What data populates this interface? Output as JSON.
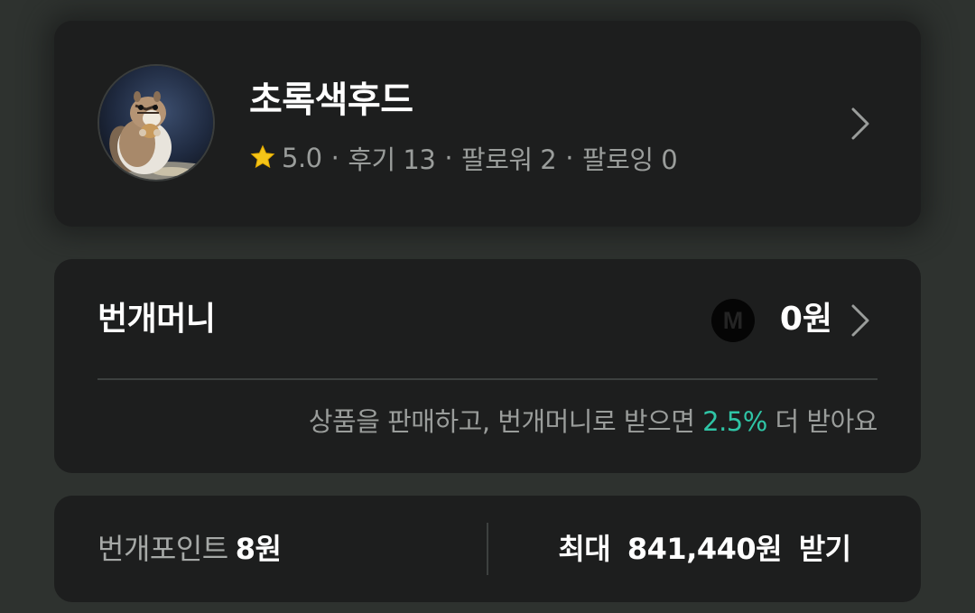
{
  "profile": {
    "nickname": "초록색후드",
    "avatar_icon": "chipmunk-photo",
    "rating": "5.0",
    "reviews": "후기 13",
    "followers": "팔로워 2",
    "following": "팔로잉 0",
    "separator": "·",
    "star_icon": "star-icon",
    "star_color": "#f5c518"
  },
  "money": {
    "title": "번개머니",
    "badge": "M",
    "amount": "0원",
    "note_prefix": "상품을 판매하고, 번개머니로 받으면",
    "note_highlight": "2.5%",
    "note_suffix": "더 받아요",
    "accent_color": "#2fc5a6"
  },
  "points": {
    "label": "번개포인트",
    "value": "8원",
    "max_prefix": "최대",
    "max_amount": "841,440원",
    "max_suffix": "받기"
  }
}
